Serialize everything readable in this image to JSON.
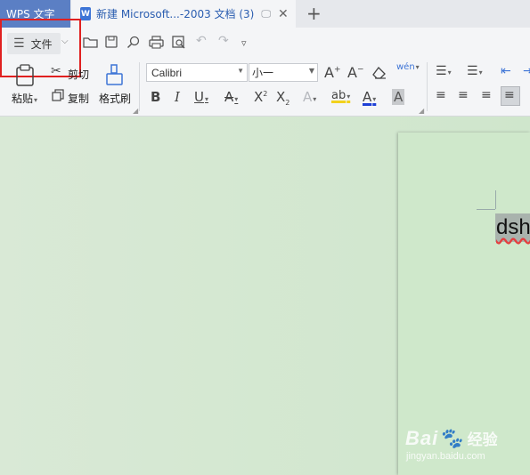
{
  "tabs": {
    "app_label": "WPS 文字",
    "doc_title": "新建 Microsoft...-2003 文档 (3)",
    "doc_icon_letter": "W",
    "add": "+"
  },
  "quick_access": {
    "file_label": "文件",
    "icons": [
      "open-folder-icon",
      "save-icon",
      "find-icon",
      "print-icon",
      "print-preview-icon",
      "undo-icon",
      "redo-icon",
      "customize-icon"
    ]
  },
  "clipboard": {
    "paste_label": "粘贴",
    "cut_label": "剪切",
    "copy_label": "复制",
    "format_painter_label": "格式刷"
  },
  "font": {
    "family": "Calibri",
    "size": "小一",
    "grow_label": "A",
    "shrink_label": "A",
    "pinyin_label": "wén"
  },
  "document": {
    "text": "dsh"
  },
  "watermark": {
    "brand": "Bai",
    "brand_cn": "经验",
    "url": "jingyan.baidu.com"
  },
  "colors": {
    "app_tab": "#5b7fc4",
    "highlight": "#e02020",
    "doc_background": "#cfe8cb"
  }
}
